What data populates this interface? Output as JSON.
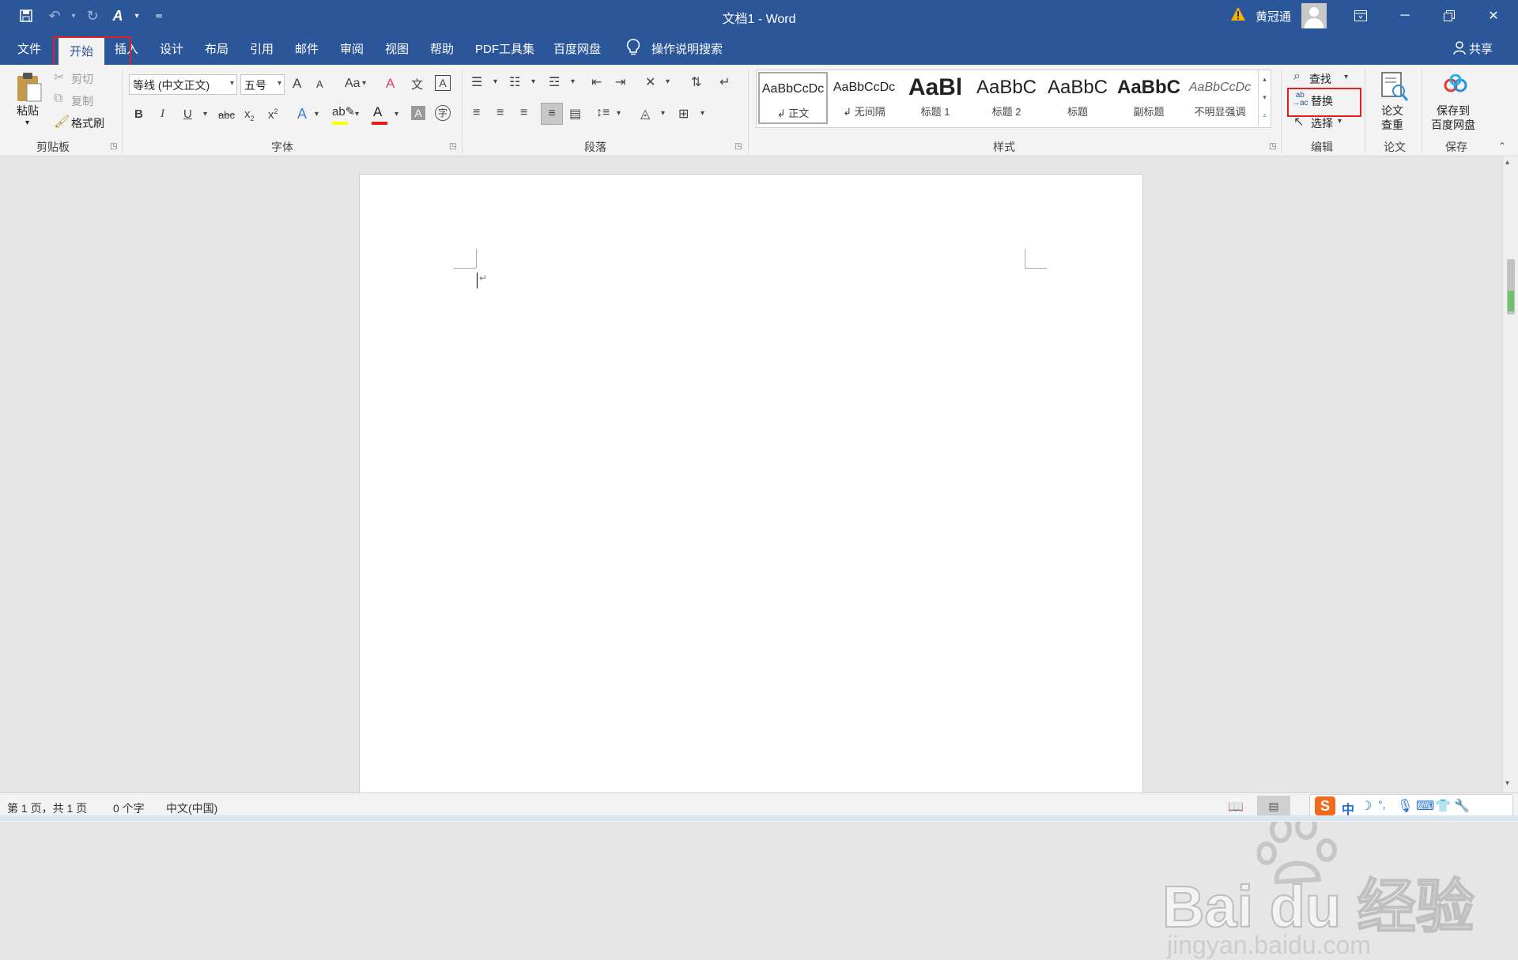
{
  "window": {
    "title": "文档1 - Word",
    "user_name": "黄冠通"
  },
  "menu_tabs": [
    "文件",
    "开始",
    "插入",
    "设计",
    "布局",
    "引用",
    "邮件",
    "审阅",
    "视图",
    "帮助",
    "PDF工具集",
    "百度网盘"
  ],
  "tell_me": "操作说明搜索",
  "share_label": "共享",
  "clipboard": {
    "paste": "粘贴",
    "cut": "剪切",
    "copy": "复制",
    "format_painter": "格式刷",
    "group_label": "剪贴板"
  },
  "font": {
    "font_name": "等线 (中文正文)",
    "font_size": "五号",
    "group_label": "字体",
    "bold": "B",
    "italic": "I",
    "underline": "U",
    "strike": "abc",
    "change_case": "Aa",
    "grow": "A",
    "shrink": "A",
    "clear_format": "A",
    "phonetic": "文",
    "char_border": "A",
    "text_effects": "A",
    "font_color": "A",
    "char_shading": "A",
    "enclose": "字",
    "subscript": "x",
    "subscript_mark": "2",
    "superscript": "x",
    "superscript_mark": "2"
  },
  "paragraph": {
    "group_label": "段落"
  },
  "styles": {
    "group_label": "样式",
    "items": [
      {
        "preview": "AaBbCcDc",
        "name": "↲ 正文"
      },
      {
        "preview": "AaBbCcDc",
        "name": "↲ 无间隔"
      },
      {
        "preview": "AaBl",
        "name": "标题 1"
      },
      {
        "preview": "AaBbC",
        "name": "标题 2"
      },
      {
        "preview": "AaBbC",
        "name": "标题"
      },
      {
        "preview": "AaBbC",
        "name": "副标题"
      },
      {
        "preview": "AaBbCcDc",
        "name": "不明显强调"
      }
    ]
  },
  "editing": {
    "find": "查找",
    "replace": "替换",
    "select": "选择",
    "group_label": "编辑"
  },
  "paper": {
    "check_line1": "论文",
    "check_line2": "查重",
    "group_label": "论文"
  },
  "save_group": {
    "line1": "保存到",
    "line2": "百度网盘",
    "group_label": "保存"
  },
  "status": {
    "page": "第 1 页，共 1 页",
    "words": "0 个字",
    "language": "中文(中国)"
  },
  "ime": {
    "logo": "S",
    "mode": "中"
  },
  "watermark": {
    "brand": "Bai du 经验",
    "url": "jingyan.baidu.com"
  },
  "colors": {
    "title_bar": "#2b579a",
    "ribbon": "#f3f3f3",
    "highlight_box": "#e02020",
    "font_color_bar": "#e02020",
    "highlight_color_bar": "#ffff00"
  }
}
